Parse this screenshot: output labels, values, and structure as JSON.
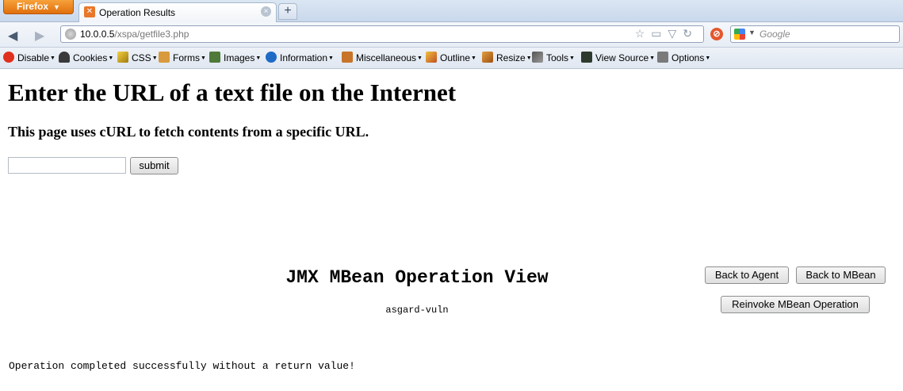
{
  "browser": {
    "app_button": "Firefox",
    "tab_title": "Operation Results",
    "new_tab_symbol": "+",
    "url_host": "10.0.0.5",
    "url_path": "/xspa/getfile3.php",
    "search_placeholder": "Google"
  },
  "devtoolbar": {
    "items": [
      "Disable",
      "Cookies",
      "CSS",
      "Forms",
      "Images",
      "Information",
      "Miscellaneous",
      "Outline",
      "Resize",
      "Tools",
      "View Source",
      "Options"
    ]
  },
  "page": {
    "heading": "Enter the URL of a text file on the Internet",
    "subheading": "This page uses cURL to fetch contents from a specific URL.",
    "url_input_value": "",
    "submit_label": "submit"
  },
  "jmx": {
    "title": "JMX MBean Operation View",
    "subtitle": "asgard-vuln",
    "back_agent_label": "Back to Agent",
    "back_mbean_label": "Back to MBean",
    "reinvoke_label": "Reinvoke MBean Operation",
    "result_text": "Operation completed successfully without a return value!"
  },
  "colors": {
    "firefox_orange": "#e0700d",
    "toolbar_blue": "#dfe7f1"
  }
}
